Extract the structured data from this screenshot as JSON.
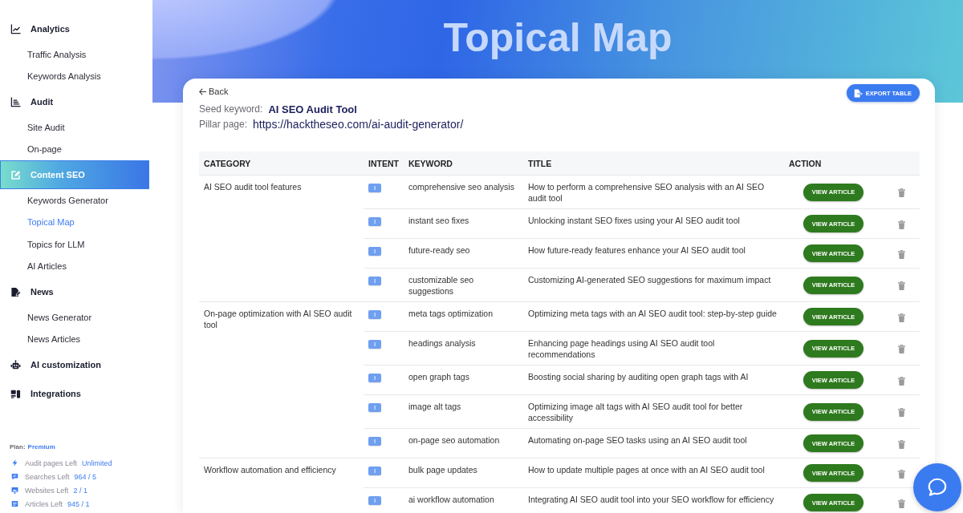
{
  "sidebar": {
    "sections": [
      {
        "label": "Analytics",
        "selected": false,
        "children": [
          {
            "label": "Traffic Analysis",
            "selected": false
          },
          {
            "label": "Keywords Analysis",
            "selected": false
          }
        ]
      },
      {
        "label": "Audit",
        "selected": false,
        "children": [
          {
            "label": "Site Audit",
            "selected": false
          },
          {
            "label": "On-page",
            "selected": false
          }
        ]
      },
      {
        "label": "Content SEO",
        "selected": true,
        "children": [
          {
            "label": "Keywords Generator",
            "selected": false
          },
          {
            "label": "Topical Map",
            "selected": true
          },
          {
            "label": "Topics for LLM",
            "selected": false
          },
          {
            "label": "AI Articles",
            "selected": false
          }
        ]
      },
      {
        "label": "News",
        "selected": false,
        "children": [
          {
            "label": "News Generator",
            "selected": false
          },
          {
            "label": "News Articles",
            "selected": false
          }
        ]
      },
      {
        "label": "AI customization",
        "selected": false
      },
      {
        "label": "Integrations",
        "selected": false
      }
    ],
    "plan": {
      "label": "Plan:",
      "value": "Premium"
    },
    "limits": [
      {
        "label": "Audit pages Left",
        "value": "Unlimited"
      },
      {
        "label": "Searches Left",
        "value": "964 / 5"
      },
      {
        "label": "Websites Left",
        "value": "2 / 1"
      },
      {
        "label": "Articles Left",
        "value": "945 / 1"
      }
    ]
  },
  "header": {
    "title": "Topical Map"
  },
  "card": {
    "back_link": "Back",
    "export_button": "EXPORT TABLE",
    "seed_keyword": {
      "label": "Seed keyword:",
      "value": "AI SEO Audit Tool"
    },
    "pillar_page": {
      "label": "Pillar page:",
      "value": "https://hacktheseo.com/ai-audit-generator/"
    }
  },
  "table": {
    "columns": [
      "CATEGORY",
      "INTENT",
      "KEYWORD",
      "TITLE",
      "ACTION"
    ],
    "groups": [
      {
        "category": "AI SEO audit tool features",
        "rows": [
          {
            "intent": "I",
            "keyword": "comprehensive seo analysis",
            "title": "How to perform a comprehensive SEO analysis with an AI SEO audit tool",
            "action": "VIEW ARTICLE"
          },
          {
            "intent": "I",
            "keyword": "instant seo fixes",
            "title": "Unlocking instant SEO fixes using your AI SEO audit tool",
            "action": "VIEW ARTICLE"
          },
          {
            "intent": "I",
            "keyword": "future-ready seo",
            "title": "How future-ready features enhance your AI SEO audit tool",
            "action": "VIEW ARTICLE"
          },
          {
            "intent": "I",
            "keyword": "customizable seo suggestions",
            "title": "Customizing AI-generated SEO suggestions for maximum impact",
            "action": "VIEW ARTICLE"
          }
        ]
      },
      {
        "category": "On-page optimization with AI SEO audit tool",
        "rows": [
          {
            "intent": "I",
            "keyword": "meta tags optimization",
            "title": "Optimizing meta tags with an AI SEO audit tool: step-by-step guide",
            "action": "VIEW ARTICLE"
          },
          {
            "intent": "I",
            "keyword": "headings analysis",
            "title": "Enhancing page headings using AI SEO audit tool recommendations",
            "action": "VIEW ARTICLE"
          },
          {
            "intent": "I",
            "keyword": "open graph tags",
            "title": "Boosting social sharing by auditing open graph tags with AI",
            "action": "VIEW ARTICLE"
          },
          {
            "intent": "I",
            "keyword": "image alt tags",
            "title": "Optimizing image alt tags with AI SEO audit tool for better accessibility",
            "action": "VIEW ARTICLE"
          },
          {
            "intent": "I",
            "keyword": "on-page seo automation",
            "title": "Automating on-page SEO tasks using an AI SEO audit tool",
            "action": "VIEW ARTICLE"
          }
        ]
      },
      {
        "category": "Workflow automation and efficiency",
        "rows": [
          {
            "intent": "I",
            "keyword": "bulk page updates",
            "title": "How to update multiple pages at once with an AI SEO audit tool",
            "action": "VIEW ARTICLE"
          },
          {
            "intent": "I",
            "keyword": "ai workflow automation",
            "title": "Integrating AI SEO audit tool into your SEO workflow for efficiency",
            "action": "VIEW ARTICLE"
          }
        ]
      }
    ]
  }
}
